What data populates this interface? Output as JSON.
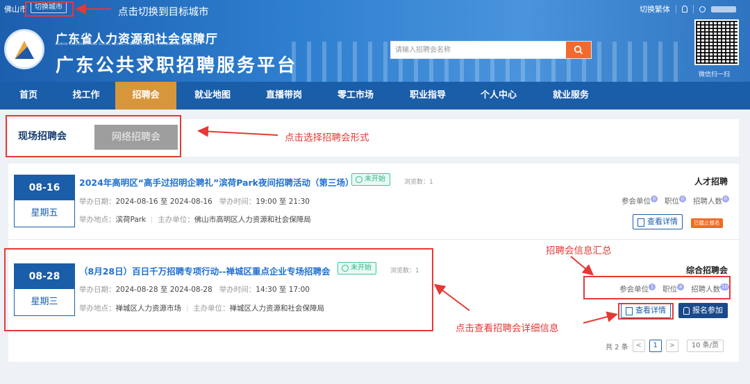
{
  "topbar": {
    "city": "佛山市",
    "switch_city": "切换城市",
    "switch_traditional": "切换繁体"
  },
  "header": {
    "dept_name": "广东省人力资源和社会保障厅",
    "dept_en": "HUMAN RESOURCES AND SOCIAL SECURITY DEPARTMENT OF GUANGDONG PROVINCE",
    "platform_name": "广东公共求职招聘服务平台",
    "search_placeholder": "请输入招聘会名称",
    "qr_caption": "微信扫一扫"
  },
  "nav": [
    "首页",
    "找工作",
    "招聘会",
    "就业地图",
    "直播带岗",
    "零工市场",
    "职业指导",
    "个人中心",
    "就业服务"
  ],
  "form_tabs": {
    "onsite": "现场招聘会",
    "online": "网络招聘会"
  },
  "fairs": [
    {
      "date": "08-16",
      "weekday": "星期五",
      "title": "2024年高明区“高手过招明企聘礼”滨荷Park夜间招聘活动（第三场）",
      "status": "未开始",
      "views": "浏览数：1",
      "date_label": "举办日期：",
      "date_start": "2024-08-16",
      "to": "至",
      "date_end": "2024-08-16",
      "time_label": "举办时间：",
      "time_start": "19:00",
      "time_end": "21:30",
      "place_label": "举办地点：",
      "place": "滨荷Park",
      "org_label": "主办单位：",
      "org": "佛山市高明区人力资源和社会保障局",
      "type": "人才招聘",
      "units_label": "参会单位",
      "units": "0",
      "jobs_label": "职位",
      "jobs": "0",
      "hires_label": "招聘人数",
      "hires": "0",
      "detail_btn": "查看详情",
      "closed": "已截止报名"
    },
    {
      "date": "08-28",
      "weekday": "星期三",
      "title": "（8月28日）百日千万招聘专项行动--禅城区重点企业专场招聘会",
      "status": "未开始",
      "views": "浏览数：1",
      "date_label": "举办日期：",
      "date_start": "2024-08-28",
      "to": "至",
      "date_end": "2024-08-28",
      "time_label": "举办时间：",
      "time_start": "14:30",
      "time_end": "17:00",
      "place_label": "举办地点：",
      "place": "禅城区人力资源市场",
      "org_label": "主办单位：",
      "org": "禅城区人力资源和社会保障局",
      "type": "综合招聘会",
      "units_label": "参会单位",
      "units": "1",
      "jobs_label": "职位",
      "jobs": "4",
      "hires_label": "招聘人数",
      "hires": "10",
      "detail_btn": "查看详情",
      "register_btn": "报名参加"
    }
  ],
  "pager": {
    "total": "共 2 条",
    "prev": "<",
    "page": "1",
    "next": ">",
    "size": "10 条/页"
  },
  "annotations": {
    "switch_city": "点击切换到目标城市",
    "select_form": "点击选择招聘会形式",
    "summary": "招聘会信息汇总",
    "view_detail": "点击查看招聘会详细信息"
  },
  "colors": {
    "nav_bg": "#1a5da8",
    "nav_active": "#d7963c",
    "annotation": "#e53935",
    "status": "#2fb68b",
    "closed": "#f06b23"
  }
}
